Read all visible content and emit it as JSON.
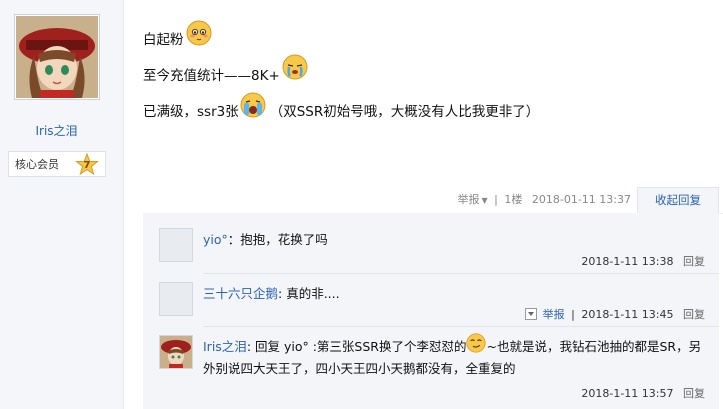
{
  "author": {
    "name": "Iris之泪",
    "badge": "核心会员",
    "level": "7"
  },
  "post": {
    "line1": "白起粉",
    "line2": "至今充值统计——8K+",
    "line3a": "已满级，ssr3张",
    "line3b": "（双SSR初始号哦，大概没有人比我更非了）",
    "report": "举报",
    "floor": "1楼",
    "time": "2018-01-11 13:37",
    "collapse": "收起回复"
  },
  "replies": [
    {
      "name": "yio°",
      "sep": "：",
      "text": "抱抱，花换了吗",
      "time": "2018-1-11 13:38",
      "reply_label": "回复"
    },
    {
      "name": "三十六只企鹅",
      "sep": ": ",
      "text": "真的非....",
      "report": "举报",
      "time": "2018-1-11 13:45",
      "reply_label": "回复"
    },
    {
      "name": "Iris之泪",
      "sep": ": ",
      "text_a": "回复 yio°  :第三张SSR换了个李怼怼的",
      "text_b": "~也就是说，我钻石池抽的都是SR，另外别说四大天王了，四小天王四小天鹅都没有，全重复的",
      "time": "2018-1-11 13:57",
      "reply_label": "回复"
    }
  ],
  "colors": {
    "link": "#2b62b8",
    "sidebar_bg": "#f4f6f9",
    "reply_bg": "#f3f5f8"
  }
}
